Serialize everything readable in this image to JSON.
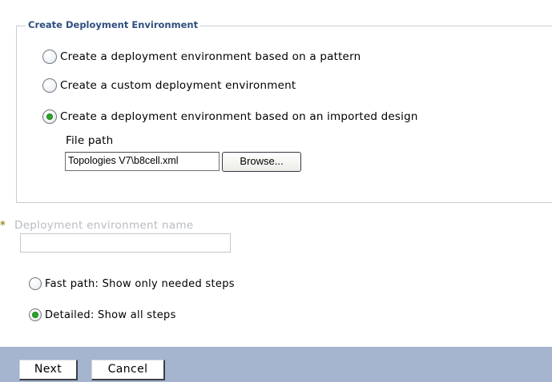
{
  "section": {
    "legend": "Create Deployment Environment"
  },
  "creation_options": [
    {
      "label": "Create a deployment environment based on a pattern",
      "selected": false
    },
    {
      "label": "Create a custom deployment environment",
      "selected": false
    },
    {
      "label": "Create a deployment environment based on an imported design",
      "selected": true
    }
  ],
  "file_path": {
    "label": "File path",
    "value": "Topologies V7\\b8cell.xml",
    "browse_label": "Browse..."
  },
  "deployment_name": {
    "required_marker": "*",
    "label": "Deployment environment name",
    "value": ""
  },
  "path_options": [
    {
      "label": "Fast path: Show only needed steps",
      "selected": false
    },
    {
      "label": "Detailed: Show all steps",
      "selected": true
    }
  ],
  "footer": {
    "next_label": "Next",
    "cancel_label": "Cancel"
  },
  "colors": {
    "legend_text": "#2f4f7f",
    "footer_bar": "#a5b4cf",
    "radio_selected": "#2aa52a",
    "disabled_text": "#b7bcc3",
    "required_marker": "#a88b2c"
  }
}
